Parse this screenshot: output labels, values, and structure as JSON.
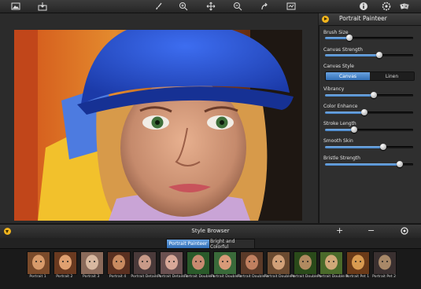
{
  "toolbar": {
    "icons": [
      "open-image-icon",
      "save-image-icon",
      "brush-tool-icon",
      "zoom-in-icon",
      "pan-tool-icon",
      "zoom-out-icon",
      "redo-icon",
      "compare-icon",
      "info-icon",
      "settings-icon",
      "randomize-icon"
    ]
  },
  "side_panel": {
    "title": "Portrait Painteer",
    "sliders": [
      {
        "label": "Brush Size",
        "value": 0.28
      },
      {
        "label": "Canvas Strength",
        "value": 0.62
      },
      {
        "label": "Vibrancy",
        "value": 0.55
      },
      {
        "label": "Color Enhance",
        "value": 0.45
      },
      {
        "label": "Stroke Length",
        "value": 0.33
      },
      {
        "label": "Smooth Skin",
        "value": 0.66
      },
      {
        "label": "Bristle Strength",
        "value": 0.85
      }
    ],
    "canvas_style": {
      "label": "Canvas Style",
      "options": [
        "Canvas",
        "Linen"
      ],
      "selected": "Canvas"
    }
  },
  "style_browser": {
    "title": "Style Browser",
    "add_symbol": "+",
    "remove_symbol": "−",
    "tabs": [
      "Portrait Painteer",
      "Bright and Colorful"
    ],
    "active_tab": "Portrait Painteer",
    "presets": [
      "Portrait 1",
      "Portrait 2",
      "Portrait 3",
      "Portrait 4",
      "Portrait Details 1",
      "Portrait Details 2",
      "Portrait Double 1",
      "Portrait Double 2",
      "Portrait Double 3",
      "Portrait Double 4",
      "Portrait Double 5",
      "Portrait Double 6",
      "Portrait Pet 1",
      "Portrait Pet 2"
    ]
  },
  "colors": {
    "accent_blue": "#3f7ec4",
    "collapse_yellow": "#f2b51d"
  }
}
